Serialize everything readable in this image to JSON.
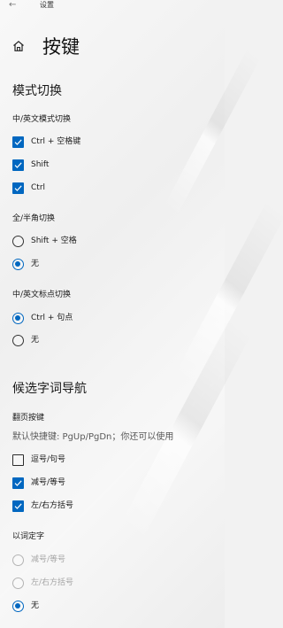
{
  "titlebar": {
    "back_icon": "back-arrow-icon",
    "app_title": "设置"
  },
  "header": {
    "home_icon": "home-icon",
    "title": "按键"
  },
  "mode_switch": {
    "title": "模式切换",
    "cn_en": {
      "label": "中/英文模式切换",
      "options": [
        {
          "label": "Ctrl + 空格键",
          "checked": true
        },
        {
          "label": "Shift",
          "checked": true
        },
        {
          "label": "Ctrl",
          "checked": true
        }
      ]
    },
    "width": {
      "label": "全/半角切换",
      "options": [
        {
          "label": "Shift + 空格",
          "selected": false
        },
        {
          "label": "无",
          "selected": true
        }
      ]
    },
    "punct": {
      "label": "中/英文标点切换",
      "options": [
        {
          "label": "Ctrl + 句点",
          "selected": true
        },
        {
          "label": "无",
          "selected": false
        }
      ]
    }
  },
  "candidate_nav": {
    "title": "候选字词导航",
    "page_keys": {
      "label": "翻页按键",
      "description": "默认快捷键: PgUp/PgDn；你还可以使用",
      "options": [
        {
          "label": "逗号/句号",
          "checked": false
        },
        {
          "label": "减号/等号",
          "checked": true
        },
        {
          "label": "左/右方括号",
          "checked": true
        }
      ]
    },
    "word_select": {
      "label": "以词定字",
      "options": [
        {
          "label": "减号/等号",
          "selected": false,
          "disabled": true
        },
        {
          "label": "左/右方括号",
          "selected": false,
          "disabled": true
        },
        {
          "label": "无",
          "selected": true,
          "disabled": false
        }
      ]
    }
  },
  "colors": {
    "accent": "#0067c0",
    "text": "#1a1a1a",
    "disabled": "#a6a6a6"
  }
}
